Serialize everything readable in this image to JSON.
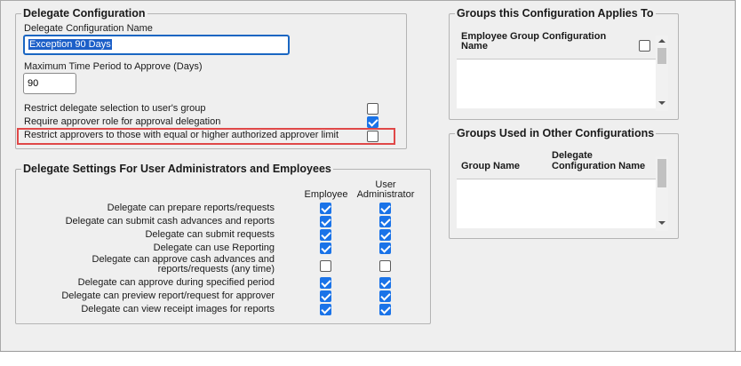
{
  "delegate_config": {
    "legend": "Delegate Configuration",
    "name_label": "Delegate Configuration Name",
    "name_value": "Exception 90 Days",
    "max_label": "Maximum Time Period to Approve (Days)",
    "max_value": "90",
    "options": [
      {
        "label": "Restrict delegate selection to user's group",
        "checked": false
      },
      {
        "label": "Require approver role for approval delegation",
        "checked": true
      },
      {
        "label": "Restrict approvers to those with equal or higher authorized approver limit",
        "checked": false
      }
    ]
  },
  "delegate_settings": {
    "legend": "Delegate Settings For User Administrators and Employees",
    "col_employee": "Employee",
    "col_admin_line1": "User",
    "col_admin_line2": "Administrator",
    "rows": [
      {
        "label": "Delegate can prepare reports/requests",
        "employee": true,
        "admin": true
      },
      {
        "label": "Delegate can submit cash advances and reports",
        "employee": true,
        "admin": true
      },
      {
        "label": "Delegate can submit requests",
        "employee": true,
        "admin": true
      },
      {
        "label": "Delegate can use Reporting",
        "employee": true,
        "admin": true
      },
      {
        "label_line1": "Delegate can approve cash advances and",
        "label_line2": "reports/requests (any time)",
        "employee": false,
        "admin": false
      },
      {
        "label": "Delegate can approve during specified period",
        "employee": true,
        "admin": true
      },
      {
        "label": "Delegate can preview report/request for approver",
        "employee": true,
        "admin": true
      },
      {
        "label": "Delegate can view receipt images for reports",
        "employee": true,
        "admin": true
      }
    ]
  },
  "groups_applies": {
    "legend": "Groups this Configuration Applies To",
    "col_line1": "Employee Group Configuration",
    "col_line2": "Name",
    "select_all_checked": false
  },
  "groups_other": {
    "legend": "Groups Used in Other Configurations",
    "col_group_name": "Group Name",
    "col_delegate_line1": "Delegate",
    "col_delegate_line2": "Configuration Name"
  },
  "colors": {
    "accent": "#1a73e8",
    "highlight": "#e04848",
    "selection": "#1c5fc8"
  }
}
